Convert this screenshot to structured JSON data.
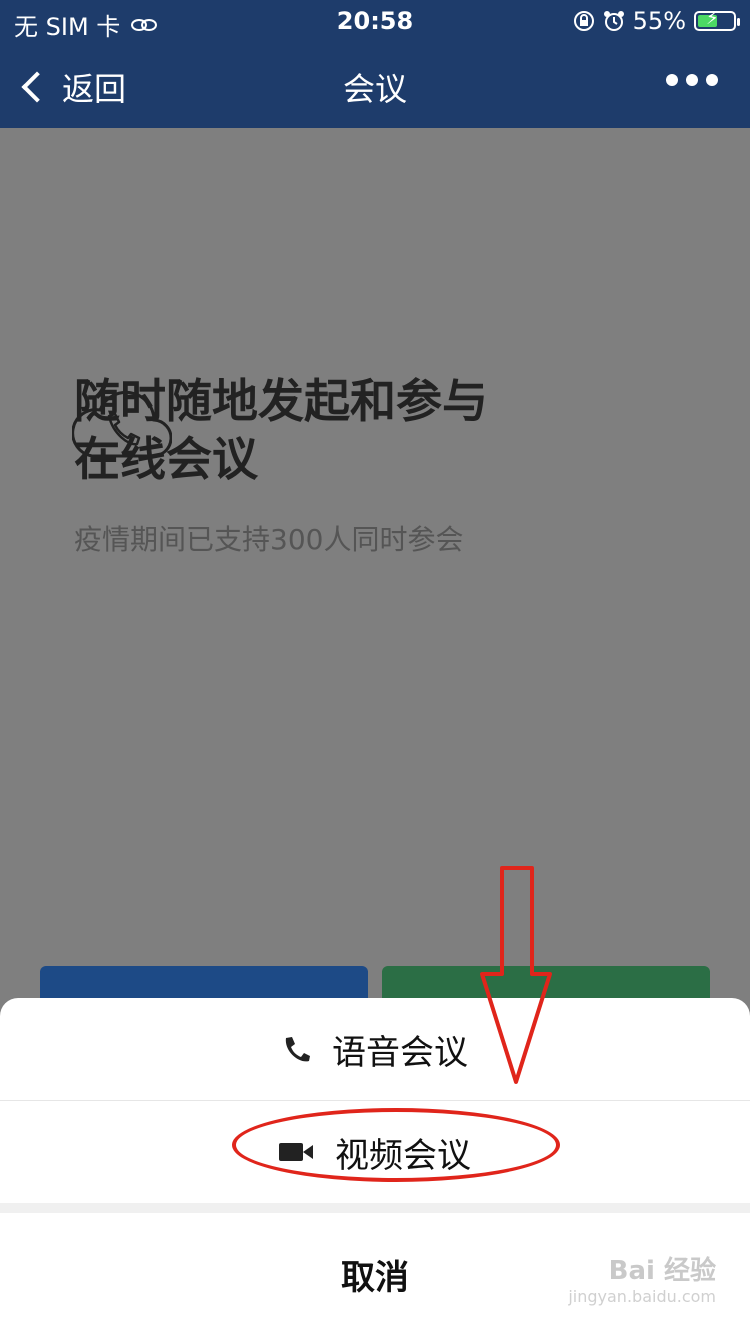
{
  "status_bar": {
    "carrier": "无 SIM 卡",
    "time": "20:58",
    "battery": "55%",
    "battery_level": 0.55
  },
  "nav": {
    "back_label": "返回",
    "title": "会议",
    "more_icon": "more-icon"
  },
  "hero": {
    "icon": "cloud-phone-icon",
    "headline_line1": "随时随地发起和参与",
    "headline_line2": "在线会议",
    "subtitle": "疫情期间已支持300人同时参会"
  },
  "action_sheet": {
    "voice_label": "语音会议",
    "video_label": "视频会议",
    "cancel_label": "取消"
  },
  "watermark": {
    "brand": "Bai 经验",
    "url": "jingyan.baidu.com"
  },
  "colors": {
    "nav_bg": "#1e3c6b",
    "overlay_bg": "#7f7f7f",
    "annotation": "#e0251b"
  }
}
